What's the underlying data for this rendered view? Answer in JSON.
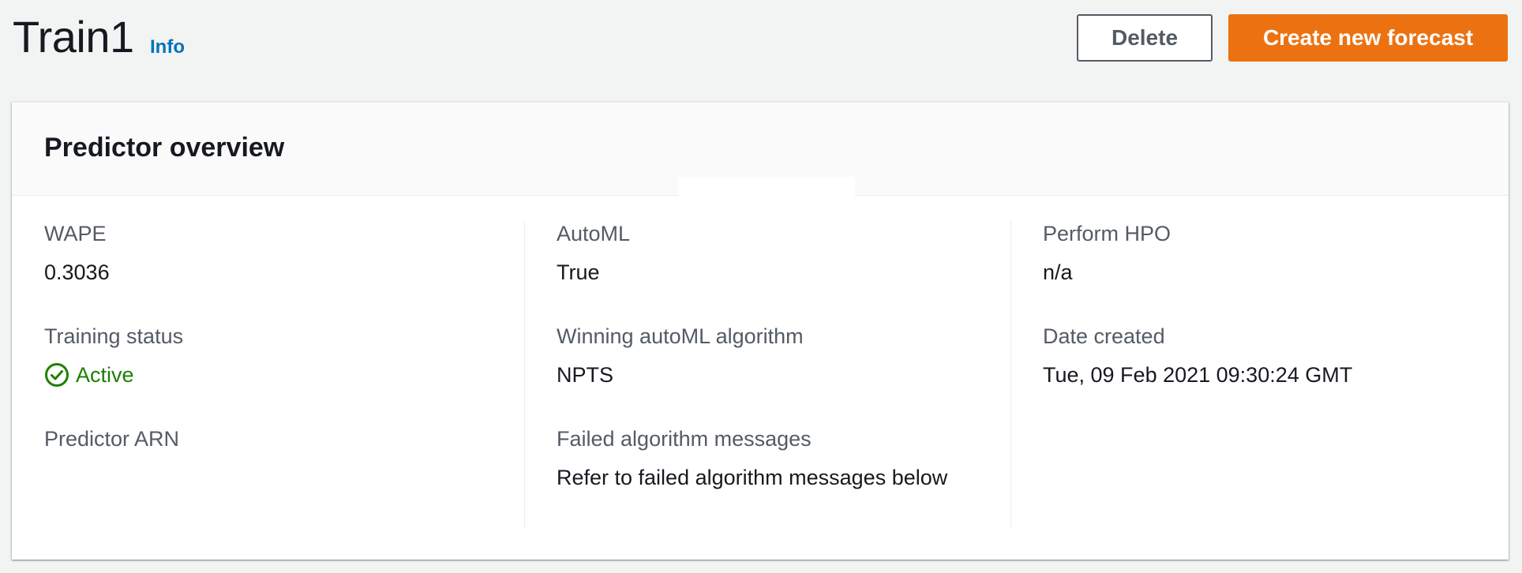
{
  "header": {
    "title": "Train1",
    "info_label": "Info",
    "delete_label": "Delete",
    "create_label": "Create new forecast"
  },
  "panel": {
    "title": "Predictor overview",
    "columns": [
      {
        "fields": [
          {
            "label": "WAPE",
            "value": "0.3036"
          },
          {
            "label": "Training status",
            "value": "Active",
            "status": "success"
          },
          {
            "label": "Predictor ARN",
            "value": ""
          }
        ]
      },
      {
        "fields": [
          {
            "label": "AutoML",
            "value": "True"
          },
          {
            "label": "Winning autoML algorithm",
            "value": "NPTS"
          },
          {
            "label": "Failed algorithm messages",
            "value": "Refer to failed algorithm messages below"
          }
        ]
      },
      {
        "fields": [
          {
            "label": "Perform HPO",
            "value": "n/a"
          },
          {
            "label": "Date created",
            "value": "Tue, 09 Feb 2021 09:30:24 GMT"
          }
        ]
      }
    ]
  },
  "colors": {
    "accent": "#ec7211",
    "link": "#0073bb",
    "success": "#1d8102",
    "label": "#545b64"
  },
  "icons": {
    "status": "check-circle-icon"
  }
}
